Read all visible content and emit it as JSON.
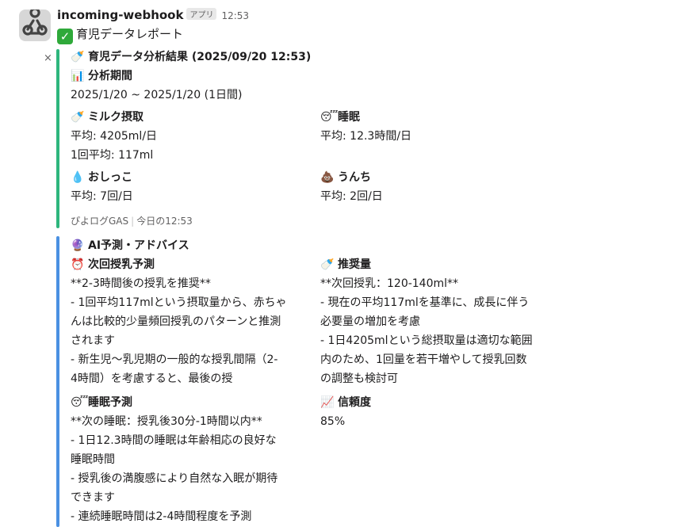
{
  "app": {
    "name": "incoming-webhook",
    "badge": "アプリ",
    "time": "12:53",
    "message": "育児データレポート",
    "close_icon": "×"
  },
  "colors": {
    "green_bar": "#2eb67d",
    "blue_bar": "#4a90e2"
  },
  "analysis": {
    "title": "育児データ分析結果 (2025/09/20 12:53)",
    "period_label": "分析期間",
    "period": "2025/1/20 ~ 2025/1/20 (1日間)",
    "milk": {
      "label": "ミルク摂取",
      "avg": "平均: 4205ml/日",
      "per": "1回平均: 117ml"
    },
    "sleep": {
      "label": "睡眠",
      "avg": "平均: 12.3時間/日"
    },
    "pee": {
      "label": "おしっこ",
      "avg": "平均: 7回/日"
    },
    "poo": {
      "label": "うんち",
      "avg": "平均: 2回/日"
    },
    "footer_source": "ぴよログGAS",
    "footer_time": "今日の12:53"
  },
  "ai": {
    "title": "AI予測・アドバイス",
    "next_feed": {
      "label": "次回授乳予測",
      "lines": [
        "**2-3時間後の授乳を推奨**",
        "- 1回平均117mlという摂取量から、赤ちゃ",
        "んは比較的少量頻回授乳のパターンと推測",
        "されます",
        "- 新生児〜乳児期の一般的な授乳間隔（2-",
        "4時間）を考慮すると、最後の授"
      ]
    },
    "recommend": {
      "label": "推奨量",
      "lines": [
        "**次回授乳：120-140ml**",
        "- 現在の平均117mlを基準に、成長に伴う",
        "必要量の増加を考慮",
        "- 1日4205mlという総摂取量は適切な範囲",
        "内のため、1回量を若干増やして授乳回数",
        "の調整も検討可"
      ]
    },
    "sleep_pred": {
      "label": "睡眠予測",
      "lines": [
        "**次の睡眠：授乳後30分-1時間以内**",
        "- 1日12.3時間の睡眠は年齢相応の良好な",
        "睡眠時間",
        "- 授乳後の満腹感により自然な入眠が期待",
        "できます",
        "- 連続睡眠時間は2-4時間程度を予測"
      ]
    },
    "confidence": {
      "label": "信頼度",
      "value": "85%"
    }
  }
}
